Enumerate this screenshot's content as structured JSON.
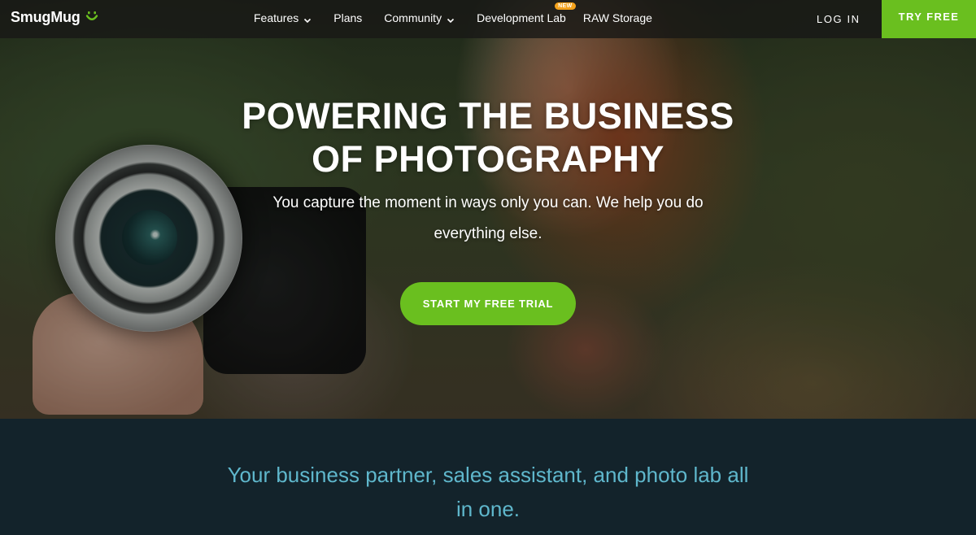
{
  "brand": {
    "name": "SmugMug",
    "accent": "#6abf1f",
    "badge_color": "#f5a21b",
    "tagline_color": "#5fb7cc"
  },
  "nav": {
    "items": [
      {
        "label": "Features",
        "has_dropdown": true
      },
      {
        "label": "Plans",
        "has_dropdown": false
      },
      {
        "label": "Community",
        "has_dropdown": true
      },
      {
        "label": "Development Lab",
        "has_dropdown": false,
        "badge": "NEW"
      },
      {
        "label": "RAW Storage",
        "has_dropdown": false
      }
    ],
    "login_label": "LOG IN",
    "try_free_label": "TRY FREE"
  },
  "hero": {
    "headline_line1": "POWERING THE BUSINESS",
    "headline_line2": "OF PHOTOGRAPHY",
    "subhead": "You capture the moment in ways only you can. We help you do everything else.",
    "cta_label": "START MY FREE TRIAL"
  },
  "lower": {
    "tagline": "Your business partner, sales assistant, and photo lab all in one."
  }
}
